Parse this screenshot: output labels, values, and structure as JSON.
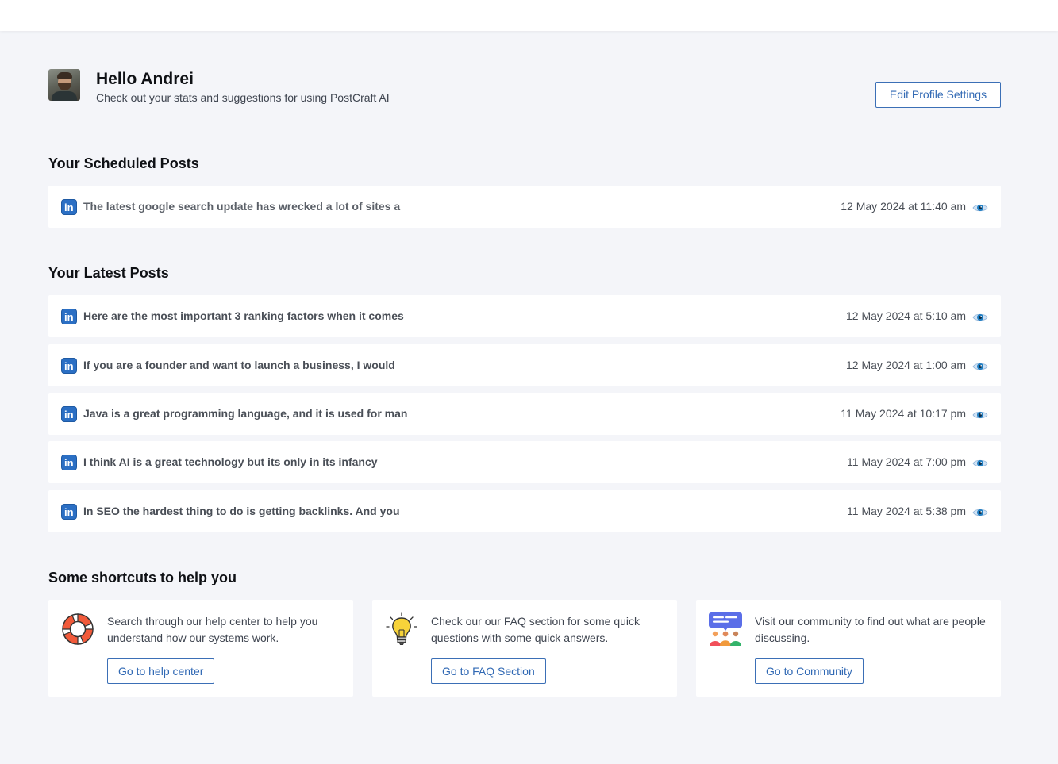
{
  "header": {
    "greeting": "Hello Andrei",
    "subtitle": "Check out your stats and suggestions for using PostCraft AI",
    "edit_profile_label": "Edit Profile Settings"
  },
  "scheduled": {
    "title": "Your Scheduled Posts",
    "posts": [
      {
        "text": "The latest google search update has wrecked a lot of sites a",
        "date": "12 May 2024 at 11:40 am",
        "network_icon": "linkedin-icon"
      }
    ]
  },
  "latest": {
    "title": "Your Latest Posts",
    "posts": [
      {
        "text": "Here are the most important 3 ranking factors when it comes",
        "date": "12 May 2024 at 5:10 am",
        "network_icon": "linkedin-icon"
      },
      {
        "text": "If you are a founder and want to launch a business, I would",
        "date": "12 May 2024 at 1:00 am",
        "network_icon": "linkedin-icon"
      },
      {
        "text": "Java is a great programming language, and it is used for man",
        "date": "11 May 2024 at 10:17 pm",
        "network_icon": "linkedin-icon"
      },
      {
        "text": "I think AI is a great technology but its only in its infancy",
        "date": "11 May 2024 at 7:00 pm",
        "network_icon": "linkedin-icon"
      },
      {
        "text": "In SEO the hardest thing to do is getting backlinks. And you",
        "date": "11 May 2024 at 5:38 pm",
        "network_icon": "linkedin-icon"
      }
    ]
  },
  "shortcuts": {
    "title": "Some shortcuts to help you",
    "items": [
      {
        "icon": "lifebuoy-icon",
        "text": "Search through our help center to help you understand how our systems work.",
        "button": "Go to help center"
      },
      {
        "icon": "lightbulb-icon",
        "text": "Check our our FAQ section for some quick questions with some quick answers.",
        "button": "Go to FAQ Section"
      },
      {
        "icon": "community-icon",
        "text": "Visit our community to find out what are people discussing.",
        "button": "Go to Community"
      }
    ]
  },
  "colors": {
    "background": "#f4f5f9",
    "accent": "#3169b4",
    "linkedin": "#2b6fc4"
  }
}
